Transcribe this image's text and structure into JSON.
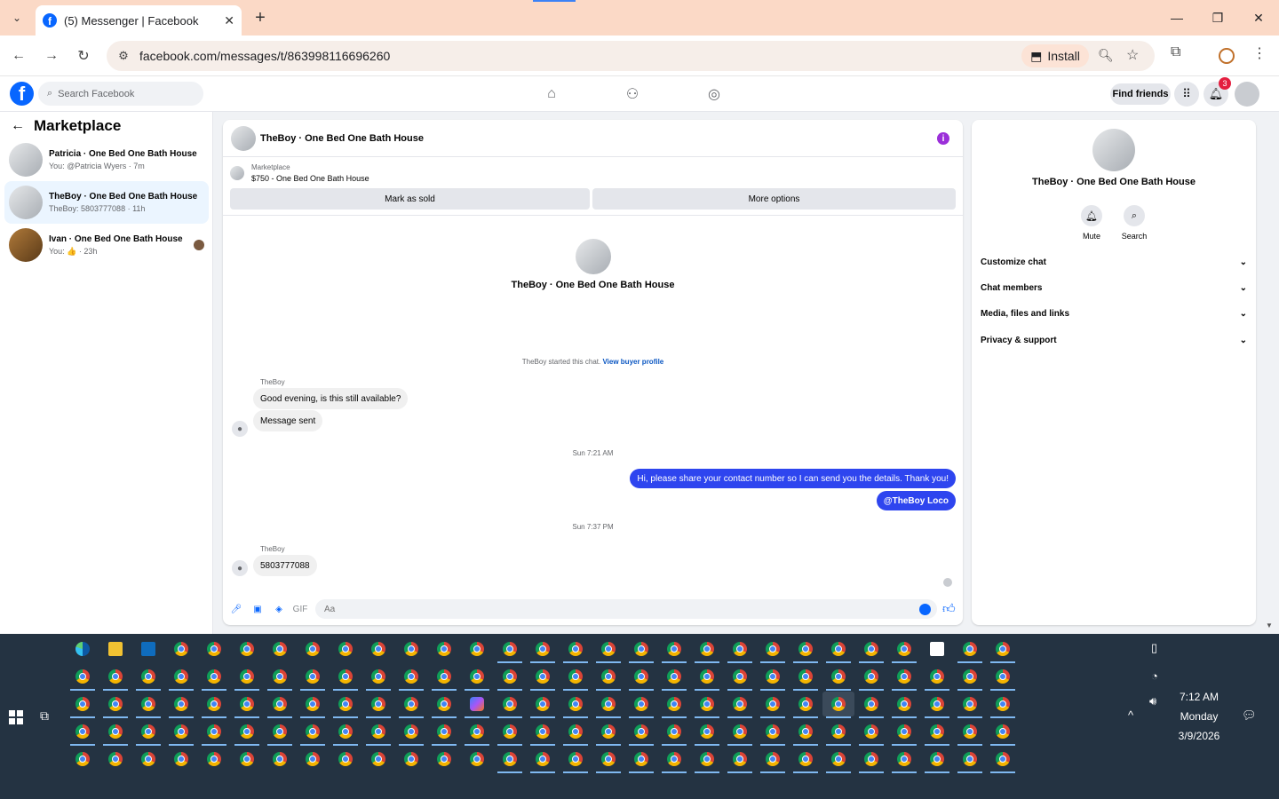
{
  "browser": {
    "tab_title": "(5) Messenger | Facebook",
    "url": "facebook.com/messages/t/863998116696260",
    "install_label": "Install"
  },
  "fb": {
    "search_placeholder": "Search Facebook",
    "find_friends": "Find friends",
    "notification_count": "3"
  },
  "left": {
    "title": "Marketplace",
    "conversations": [
      {
        "name": "Patricia · One Bed One Bath House",
        "preview": "You: @Patricia Wyers · 7m"
      },
      {
        "name": "TheBoy · One Bed One Bath House",
        "preview": "TheBoy: 5803777088 · 11h"
      },
      {
        "name": "Ivan · One Bed One Bath House",
        "preview": "You: 👍 · 23h"
      }
    ]
  },
  "chat": {
    "title": "TheBoy · One Bed One Bath House",
    "listing_label": "Marketplace",
    "listing_price": "$750 - One Bed One Bath House",
    "mark_sold": "Mark as sold",
    "more_options": "More options",
    "intro_name": "TheBoy · One Bed One Bath House",
    "started_text": "TheBoy started this chat.",
    "view_buyer": "View buyer profile",
    "sender1": "TheBoy",
    "msg1": "Good evening, is this still available?",
    "msg2": "Message sent",
    "time1": "Sun 7:21 AM",
    "out1": "Hi, please share your contact number so I can send you the details. Thank you!",
    "out2": "@TheBoy Loco",
    "time2": "Sun 7:37 PM",
    "sender2": "TheBoy",
    "msg3": "5803777088",
    "input_placeholder": "Aa"
  },
  "right": {
    "name": "TheBoy · One Bed One Bath House",
    "mute": "Mute",
    "search": "Search",
    "sections": [
      "Customize chat",
      "Chat members",
      "Media, files and links",
      "Privacy & support"
    ]
  },
  "taskbar": {
    "time": "7:12 AM",
    "day": "Monday",
    "date": "3/9/2026"
  },
  "colors": {
    "fb_blue": "#0866ff",
    "outgoing_bubble": "#2e45ef",
    "titlebar": "#fbd9c6",
    "taskbar": "#243342"
  }
}
